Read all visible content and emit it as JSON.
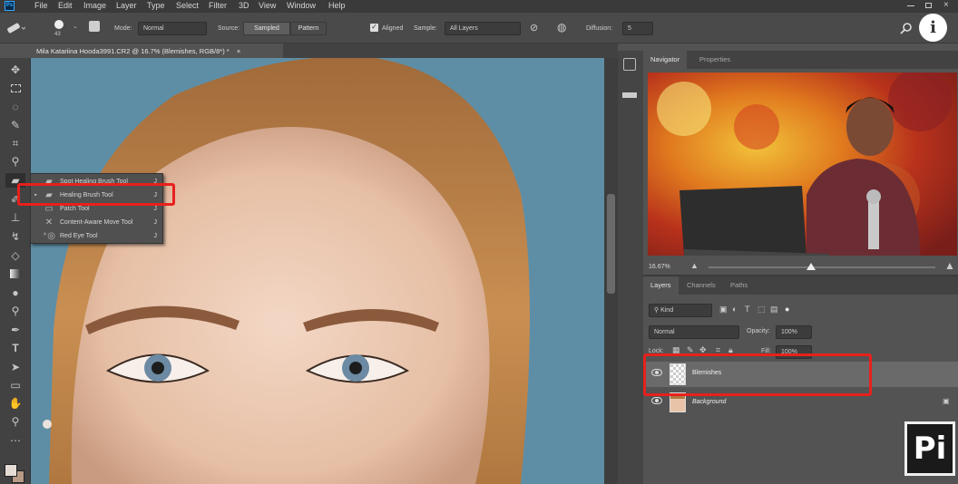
{
  "menu": {
    "items": [
      "File",
      "Edit",
      "Image",
      "Layer",
      "Type",
      "Select",
      "Filter",
      "3D",
      "View",
      "Window",
      "Help"
    ]
  },
  "options": {
    "brush_size": "43",
    "mode_label": "Mode:",
    "mode_value": "Normal",
    "source_label": "Source:",
    "sampled_label": "Sampled",
    "pattern_label": "Pattern",
    "aligned_label": "Aligned",
    "sample_label": "Sample:",
    "sample_value": "All Layers",
    "diffusion_label": "Diffusion:",
    "diffusion_value": "5"
  },
  "document": {
    "tab_title": "Mila Katariina Hooda3991.CR2 @ 16.7% (Blemishes, RGB/8*) *",
    "close_glyph": "×"
  },
  "flyout": {
    "items": [
      {
        "label": "Spot Healing Brush Tool",
        "shortcut": "J"
      },
      {
        "label": "Healing Brush Tool",
        "shortcut": "J"
      },
      {
        "label": "Patch Tool",
        "shortcut": "J"
      },
      {
        "label": "Content-Aware Move Tool",
        "shortcut": "J"
      },
      {
        "label": "Red Eye Tool",
        "shortcut": "J"
      }
    ]
  },
  "navigator": {
    "tab_navigator": "Navigator",
    "tab_properties": "Properties",
    "zoom": "16.67%",
    "zoom_slider_level": 0.45
  },
  "layers": {
    "tab_layers": "Layers",
    "tab_channels": "Channels",
    "tab_paths": "Paths",
    "filter_kind": "Kind",
    "blend_mode": "Normal",
    "opacity_label": "Opacity:",
    "opacity_value": "100%",
    "lock_label": "Lock:",
    "fill_label": "Fill:",
    "fill_value": "100%",
    "rows": [
      {
        "name": "Blemishes"
      },
      {
        "name": "Background"
      }
    ]
  },
  "watermark": {
    "info_glyph": "i",
    "logo_text": "Pi"
  },
  "colors": {
    "accent_red": "#e8201c",
    "canvas_bg": "#5e8ea6",
    "panel_bg": "#535353"
  }
}
